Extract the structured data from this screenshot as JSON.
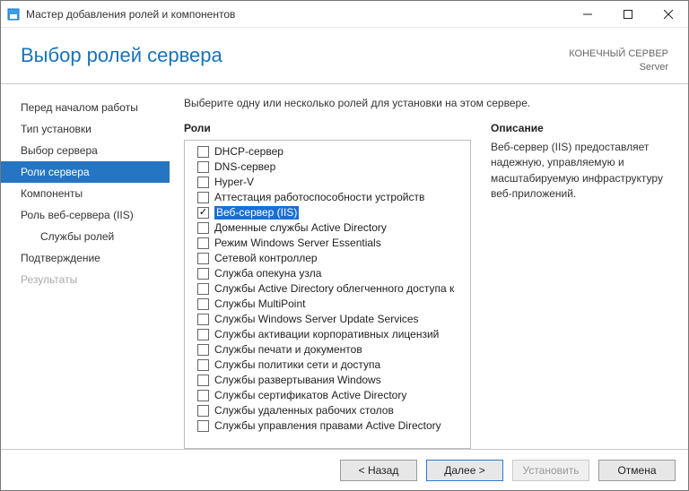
{
  "window": {
    "title": "Мастер добавления ролей и компонентов"
  },
  "header": {
    "title": "Выбор ролей сервера",
    "destination_label": "КОНЕЧНЫЙ СЕРВЕР",
    "destination_value": "Server"
  },
  "sidebar": {
    "items": [
      {
        "label": "Перед началом работы",
        "active": false,
        "disabled": false
      },
      {
        "label": "Тип установки",
        "active": false,
        "disabled": false
      },
      {
        "label": "Выбор сервера",
        "active": false,
        "disabled": false
      },
      {
        "label": "Роли сервера",
        "active": true,
        "disabled": false
      },
      {
        "label": "Компоненты",
        "active": false,
        "disabled": false
      },
      {
        "label": "Роль веб-сервера (IIS)",
        "active": false,
        "disabled": false
      },
      {
        "label": "Службы ролей",
        "active": false,
        "disabled": false,
        "sub": true
      },
      {
        "label": "Подтверждение",
        "active": false,
        "disabled": false
      },
      {
        "label": "Результаты",
        "active": false,
        "disabled": true
      }
    ]
  },
  "main": {
    "instruction": "Выберите одну или несколько ролей для установки на этом сервере.",
    "roles_heading": "Роли",
    "description_heading": "Описание",
    "description_text": "Веб-сервер (IIS) предоставляет надежную, управляемую и масштабируемую инфраструктуру веб-приложений.",
    "roles": [
      {
        "label": "DHCP-сервер",
        "checked": false,
        "selected": false
      },
      {
        "label": "DNS-сервер",
        "checked": false,
        "selected": false
      },
      {
        "label": "Hyper-V",
        "checked": false,
        "selected": false
      },
      {
        "label": "Аттестация работоспособности устройств",
        "checked": false,
        "selected": false
      },
      {
        "label": "Веб-сервер (IIS)",
        "checked": true,
        "selected": true
      },
      {
        "label": "Доменные службы Active Directory",
        "checked": false,
        "selected": false
      },
      {
        "label": "Режим Windows Server Essentials",
        "checked": false,
        "selected": false
      },
      {
        "label": "Сетевой контроллер",
        "checked": false,
        "selected": false
      },
      {
        "label": "Служба опекуна узла",
        "checked": false,
        "selected": false
      },
      {
        "label": "Службы Active Directory облегченного доступа к",
        "checked": false,
        "selected": false
      },
      {
        "label": "Службы MultiPoint",
        "checked": false,
        "selected": false
      },
      {
        "label": "Службы Windows Server Update Services",
        "checked": false,
        "selected": false
      },
      {
        "label": "Службы активации корпоративных лицензий",
        "checked": false,
        "selected": false
      },
      {
        "label": "Службы печати и документов",
        "checked": false,
        "selected": false
      },
      {
        "label": "Службы политики сети и доступа",
        "checked": false,
        "selected": false
      },
      {
        "label": "Службы развертывания Windows",
        "checked": false,
        "selected": false
      },
      {
        "label": "Службы сертификатов Active Directory",
        "checked": false,
        "selected": false
      },
      {
        "label": "Службы удаленных рабочих столов",
        "checked": false,
        "selected": false
      },
      {
        "label": "Службы управления правами Active Directory",
        "checked": false,
        "selected": false
      }
    ]
  },
  "footer": {
    "back": "< Назад",
    "next": "Далее >",
    "install": "Установить",
    "cancel": "Отмена"
  }
}
